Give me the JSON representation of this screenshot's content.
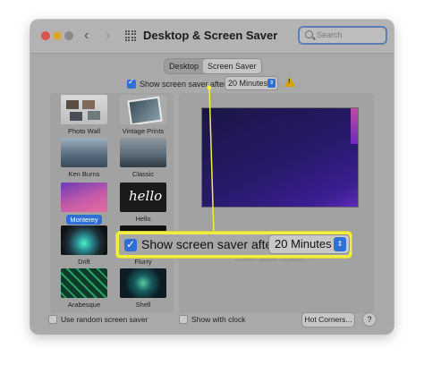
{
  "window": {
    "title": "Desktop & Screen Saver",
    "search_placeholder": "Search"
  },
  "tabs": [
    {
      "label": "Desktop",
      "active": false
    },
    {
      "label": "Screen Saver",
      "active": true
    }
  ],
  "screen_saver_after": {
    "checked": true,
    "label": "Show screen saver after",
    "value": "20 Minutes",
    "warning_icon": "warning-triangle-icon"
  },
  "savers": [
    {
      "name": "Photo Wall",
      "selected": false
    },
    {
      "name": "Vintage Prints",
      "selected": false
    },
    {
      "name": "Ken Burns",
      "selected": false
    },
    {
      "name": "Classic",
      "selected": false
    },
    {
      "name": "Monterey",
      "selected": true
    },
    {
      "name": "Hello",
      "selected": false
    },
    {
      "name": "Drift",
      "selected": false
    },
    {
      "name": "Flurry",
      "selected": false
    },
    {
      "name": "Arabesque",
      "selected": false
    },
    {
      "name": "Shell",
      "selected": false
    }
  ],
  "preview": {
    "options_button": "Screen Saver Options..."
  },
  "bottom": {
    "random_label": "Use random screen saver",
    "random_checked": false,
    "clock_label": "Show with clock",
    "clock_checked": false,
    "hot_corners": "Hot Corners...",
    "help": "?"
  },
  "callout": {
    "label": "Show screen saver after",
    "value": "20 Minutes",
    "color": "#f1ee3f"
  },
  "colors": {
    "accent": "#2f6fd6",
    "window_bg": "#a9a9a9"
  }
}
